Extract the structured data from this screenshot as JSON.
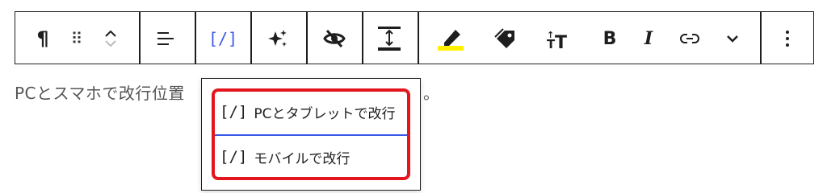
{
  "toolbar": {
    "paragraph_icon": "¶",
    "drag_handle_icon": "⠿",
    "link_bracket": "[/]",
    "bold": "B",
    "italic": "I"
  },
  "paragraph": {
    "text_before": "PCとスマホで改行位置",
    "text_after": "。"
  },
  "dropdown": {
    "items": [
      {
        "icon": "[/]",
        "label": "PCとタブレットで改行"
      },
      {
        "icon": "[/]",
        "label": "モバイルで改行"
      }
    ]
  },
  "colors": {
    "border": "#1e1e1e",
    "accent": "#3858e9",
    "highlight_box": "#e4161d",
    "highlighter": "#fff100"
  }
}
